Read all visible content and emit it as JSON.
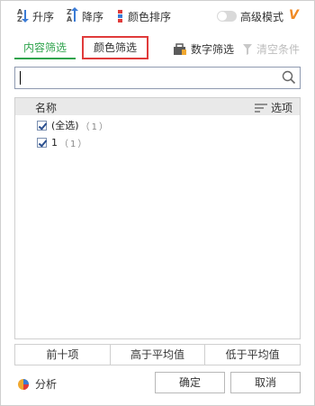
{
  "toolbar": {
    "asc_label": "升序",
    "desc_label": "降序",
    "color_sort_label": "颜色排序",
    "advanced_mode_label": "高级模式",
    "vip_badge": "V"
  },
  "tabs": {
    "content_filter": "内容筛选",
    "color_filter": "颜色筛选"
  },
  "actions": {
    "number_filter": "数字筛选",
    "clear_conditions": "清空条件"
  },
  "search": {
    "value": "",
    "placeholder": ""
  },
  "list": {
    "header_name": "名称",
    "header_options": "选项",
    "items": [
      {
        "label": "(全选)",
        "count": "（1）",
        "checked": true
      },
      {
        "label": "1",
        "count": "（1）",
        "checked": true
      }
    ]
  },
  "quick_filters": {
    "top_ten": "前十项",
    "above_average": "高于平均值",
    "below_average": "低于平均值"
  },
  "footer": {
    "analysis_label": "分析",
    "ok_label": "确定",
    "cancel_label": "取消"
  },
  "colors": {
    "accent_green": "#2ea34c",
    "highlight_red": "#e03b3b",
    "vip_orange": "#f08a24",
    "sort_arrow_blue": "#3a7bd5"
  }
}
